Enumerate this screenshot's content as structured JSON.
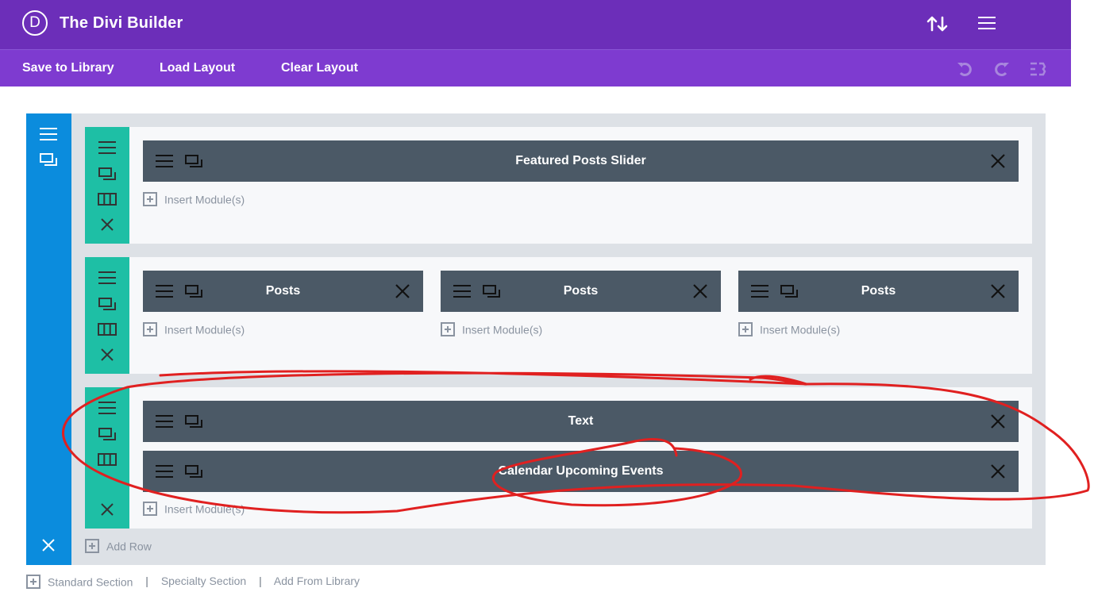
{
  "header": {
    "logo_letter": "D",
    "title": "The Divi Builder"
  },
  "toolbar": {
    "save_to_library": "Save to Library",
    "load_layout": "Load Layout",
    "clear_layout": "Clear Layout"
  },
  "rows": [
    {
      "modules": [
        "Featured Posts Slider"
      ],
      "insert_label": "Insert Module(s)"
    },
    {
      "columns": [
        {
          "module": "Posts",
          "insert_label": "Insert Module(s)"
        },
        {
          "module": "Posts",
          "insert_label": "Insert Module(s)"
        },
        {
          "module": "Posts",
          "insert_label": "Insert Module(s)"
        }
      ]
    },
    {
      "modules": [
        "Text",
        "Calendar Upcoming Events"
      ],
      "insert_label": "Insert Module(s)"
    }
  ],
  "add_row_label": "Add Row",
  "bottom_links": {
    "standard_section": "Standard Section",
    "separator": "|",
    "specialty_section": "Specialty Section",
    "add_from_library": "Add From Library"
  },
  "colors": {
    "header": "#6C2EB9",
    "toolbar": "#7E3BD0",
    "section_bar": "#0B8CDD",
    "row_bar": "#1EBFA5",
    "module": "#4B5966",
    "annotation": "#E02020"
  }
}
